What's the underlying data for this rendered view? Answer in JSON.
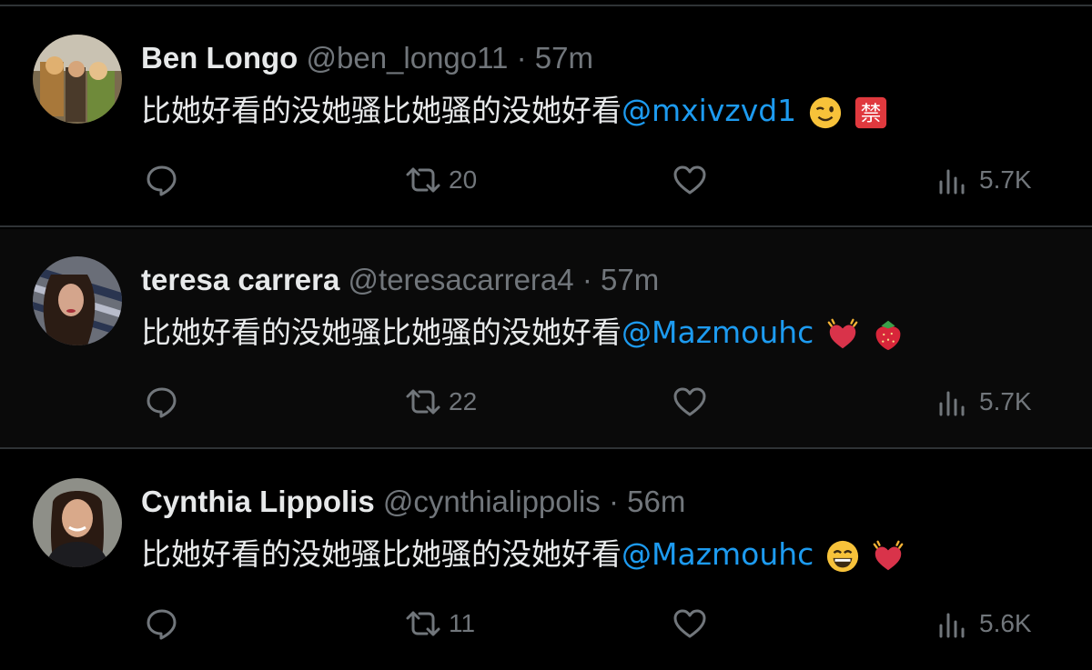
{
  "tweets": [
    {
      "name": "Ben Longo",
      "handle": "@ben_longo11",
      "separator": "·",
      "time": "57m",
      "text": "比她好看的没她骚比她骚的没她好看",
      "mention": "@mxivzvd1",
      "emojis": [
        "winking-face-emoji",
        "prohibited-kanji-emoji"
      ],
      "retweets": "20",
      "views": "5.7K"
    },
    {
      "name": "teresa carrera",
      "handle": "@teresacarrera4",
      "separator": "·",
      "time": "57m",
      "text": "比她好看的没她骚比她骚的没她好看",
      "mention": "@Mazmouhc",
      "emojis": [
        "beating-heart-emoji",
        "strawberry-emoji"
      ],
      "retweets": "22",
      "views": "5.7K"
    },
    {
      "name": "Cynthia Lippolis",
      "handle": "@cynthialippolis",
      "separator": "·",
      "time": "56m",
      "text": "比她好看的没她骚比她骚的没她好看",
      "mention": "@Mazmouhc",
      "emojis": [
        "grinning-face-emoji",
        "beating-heart-emoji"
      ],
      "retweets": "11",
      "views": "5.6K"
    }
  ],
  "colors": {
    "background": "#000000",
    "text": "#e7e9ea",
    "muted": "#71767b",
    "link": "#1d9bf0",
    "divider": "#2f3336"
  }
}
